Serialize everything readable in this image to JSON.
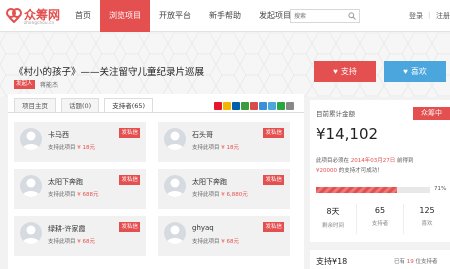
{
  "nav": {
    "logo": "众筹网",
    "logo_sub": "zhongchou.cn",
    "items": [
      "首页",
      "浏览项目",
      "开放平台",
      "新手帮助",
      "发起项目"
    ],
    "search_placeholder": "搜索",
    "login": "登录",
    "separator": "|",
    "register": "注册"
  },
  "project": {
    "title": "《村小的孩子》——关注留守儿童纪录片巡展",
    "sponsor_tag": "发起人",
    "owner": "蒋能杰"
  },
  "tabs": [
    "项目主页",
    "话题(0)",
    "支持者(65)"
  ],
  "share_icons": [
    {
      "name": "weibo",
      "color": "#e6162d"
    },
    {
      "name": "qzone",
      "color": "#f5b400"
    },
    {
      "name": "renren",
      "color": "#005eac"
    },
    {
      "name": "douban",
      "color": "#3c9c3c"
    },
    {
      "name": "kaixin",
      "color": "#d74b4b"
    },
    {
      "name": "tqq",
      "color": "#3a8fd8"
    },
    {
      "name": "qq",
      "color": "#4aa6dd"
    },
    {
      "name": "msn",
      "color": "#2aa640"
    },
    {
      "name": "more",
      "color": "#888888"
    }
  ],
  "backers": [
    {
      "name": "卡马西",
      "prefix": "支持此项目",
      "amount": "¥ 18元",
      "badge": "发私信"
    },
    {
      "name": "石头哥",
      "prefix": "支持此项目",
      "amount": "¥ 18元",
      "badge": "发私信"
    },
    {
      "name": "太阳下奔跑",
      "prefix": "支持此项目",
      "amount": "¥ 688元",
      "badge": "发私信"
    },
    {
      "name": "太阳下奔跑",
      "prefix": "支持此项目",
      "amount": "¥ 6,880元",
      "badge": "发私信"
    },
    {
      "name": "绿耕-许家霞",
      "prefix": "支持此项目",
      "amount": "¥ 68元",
      "badge": "发私信"
    },
    {
      "name": "ghyaq",
      "prefix": "支持此项目",
      "amount": "¥ 68元",
      "badge": "发私信"
    }
  ],
  "side": {
    "support_label": "支持",
    "like_label": "喜欢",
    "raised_label": "目前累计金额",
    "status": "众筹中",
    "total": "¥14,102",
    "desc_1a": "此项目必须在 ",
    "deadline": "2014年03月27日",
    "desc_1b": " 前得到",
    "goal": "¥20000",
    "desc_2": " 的支持才可成功！",
    "progress_pct": 71,
    "progress_label": "71%",
    "stats": [
      {
        "value": "8天",
        "label": "剩余时间"
      },
      {
        "value": "65",
        "label": "支持者"
      },
      {
        "value": "125",
        "label": "喜欢"
      }
    ],
    "support_amount": "支持¥18",
    "support_count_a": "已有 ",
    "support_count_n": "19",
    "support_count_b": " 位支持者"
  },
  "colors": {
    "accent": "#e44f4f",
    "like_blue": "#4aa6dd"
  }
}
